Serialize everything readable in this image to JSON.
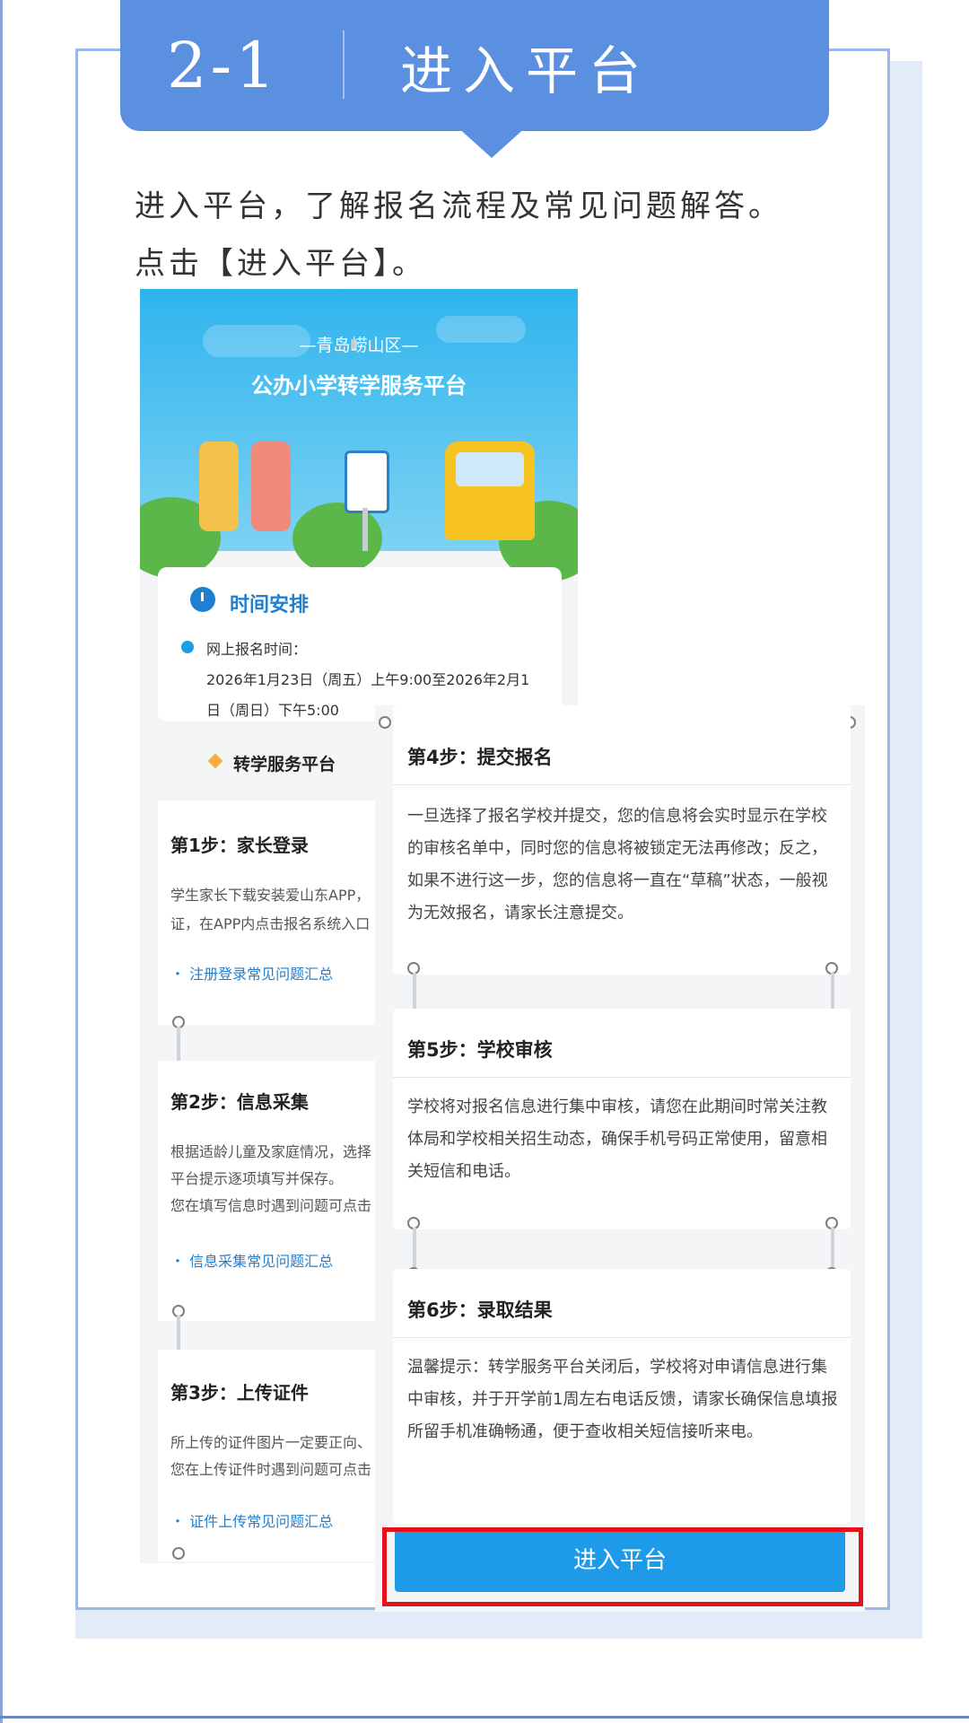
{
  "banner": {
    "number": "2-1",
    "title": "进入平台"
  },
  "intro": {
    "line1": "进入平台，了解报名流程及常见问题解答。",
    "line2": "点击【进入平台】。"
  },
  "platform": {
    "hero_subtitle": "—青岛崂山区—",
    "hero_title": "公办小学转学服务平台",
    "schedule": {
      "title": "时间安排",
      "label": "网上报名时间：",
      "line1": "2026年1月23日（周五）上午9:00至2026年2月1",
      "line2": "日（周日）下午5:00"
    },
    "service_title": "转学服务平台",
    "steps_left": [
      {
        "title": "第1步：家长登录",
        "text1": "学生家长下载安装爱山东APP，",
        "text2": "证，在APP内点击报名系统入口",
        "link": "・ 注册登录常见问题汇总"
      },
      {
        "title": "第2步：信息采集",
        "text1": "根据适龄儿童及家庭情况，选择",
        "text2": "平台提示逐项填写并保存。",
        "text3": "您在填写信息时遇到问题可点击",
        "link": "・ 信息采集常见问题汇总"
      },
      {
        "title": "第3步：上传证件",
        "text1": "所上传的证件图片一定要正向、",
        "text2": "您在上传证件时遇到问题可点击",
        "link": "・ 证件上传常见问题汇总"
      }
    ],
    "steps_right": [
      {
        "title": "第4步：提交报名",
        "text": "一旦选择了报名学校并提交，您的信息将会实时显示在学校的审核名单中，同时您的信息将被锁定无法再修改；反之，如果不进行这一步，您的信息将一直在“草稿”状态，一般视为无效报名，请家长注意提交。"
      },
      {
        "title": "第5步：学校审核",
        "text": "学校将对报名信息进行集中审核，请您在此期间时常关注教体局和学校相关招生动态，确保手机号码正常使用，留意相关短信和电话。"
      },
      {
        "title": "第6步：录取结果",
        "text": "温馨提示：转学服务平台关闭后，学校将对申请信息进行集中审核，并于开学前1周左右电话反馈，请家长确保信息填报所留手机准确畅通，便于查收相关短信接听来电。"
      }
    ],
    "enter_button": "进入平台"
  },
  "colors": {
    "banner": "#5b8fe0",
    "accent": "#1e9be8",
    "highlight": "#e8111b"
  }
}
